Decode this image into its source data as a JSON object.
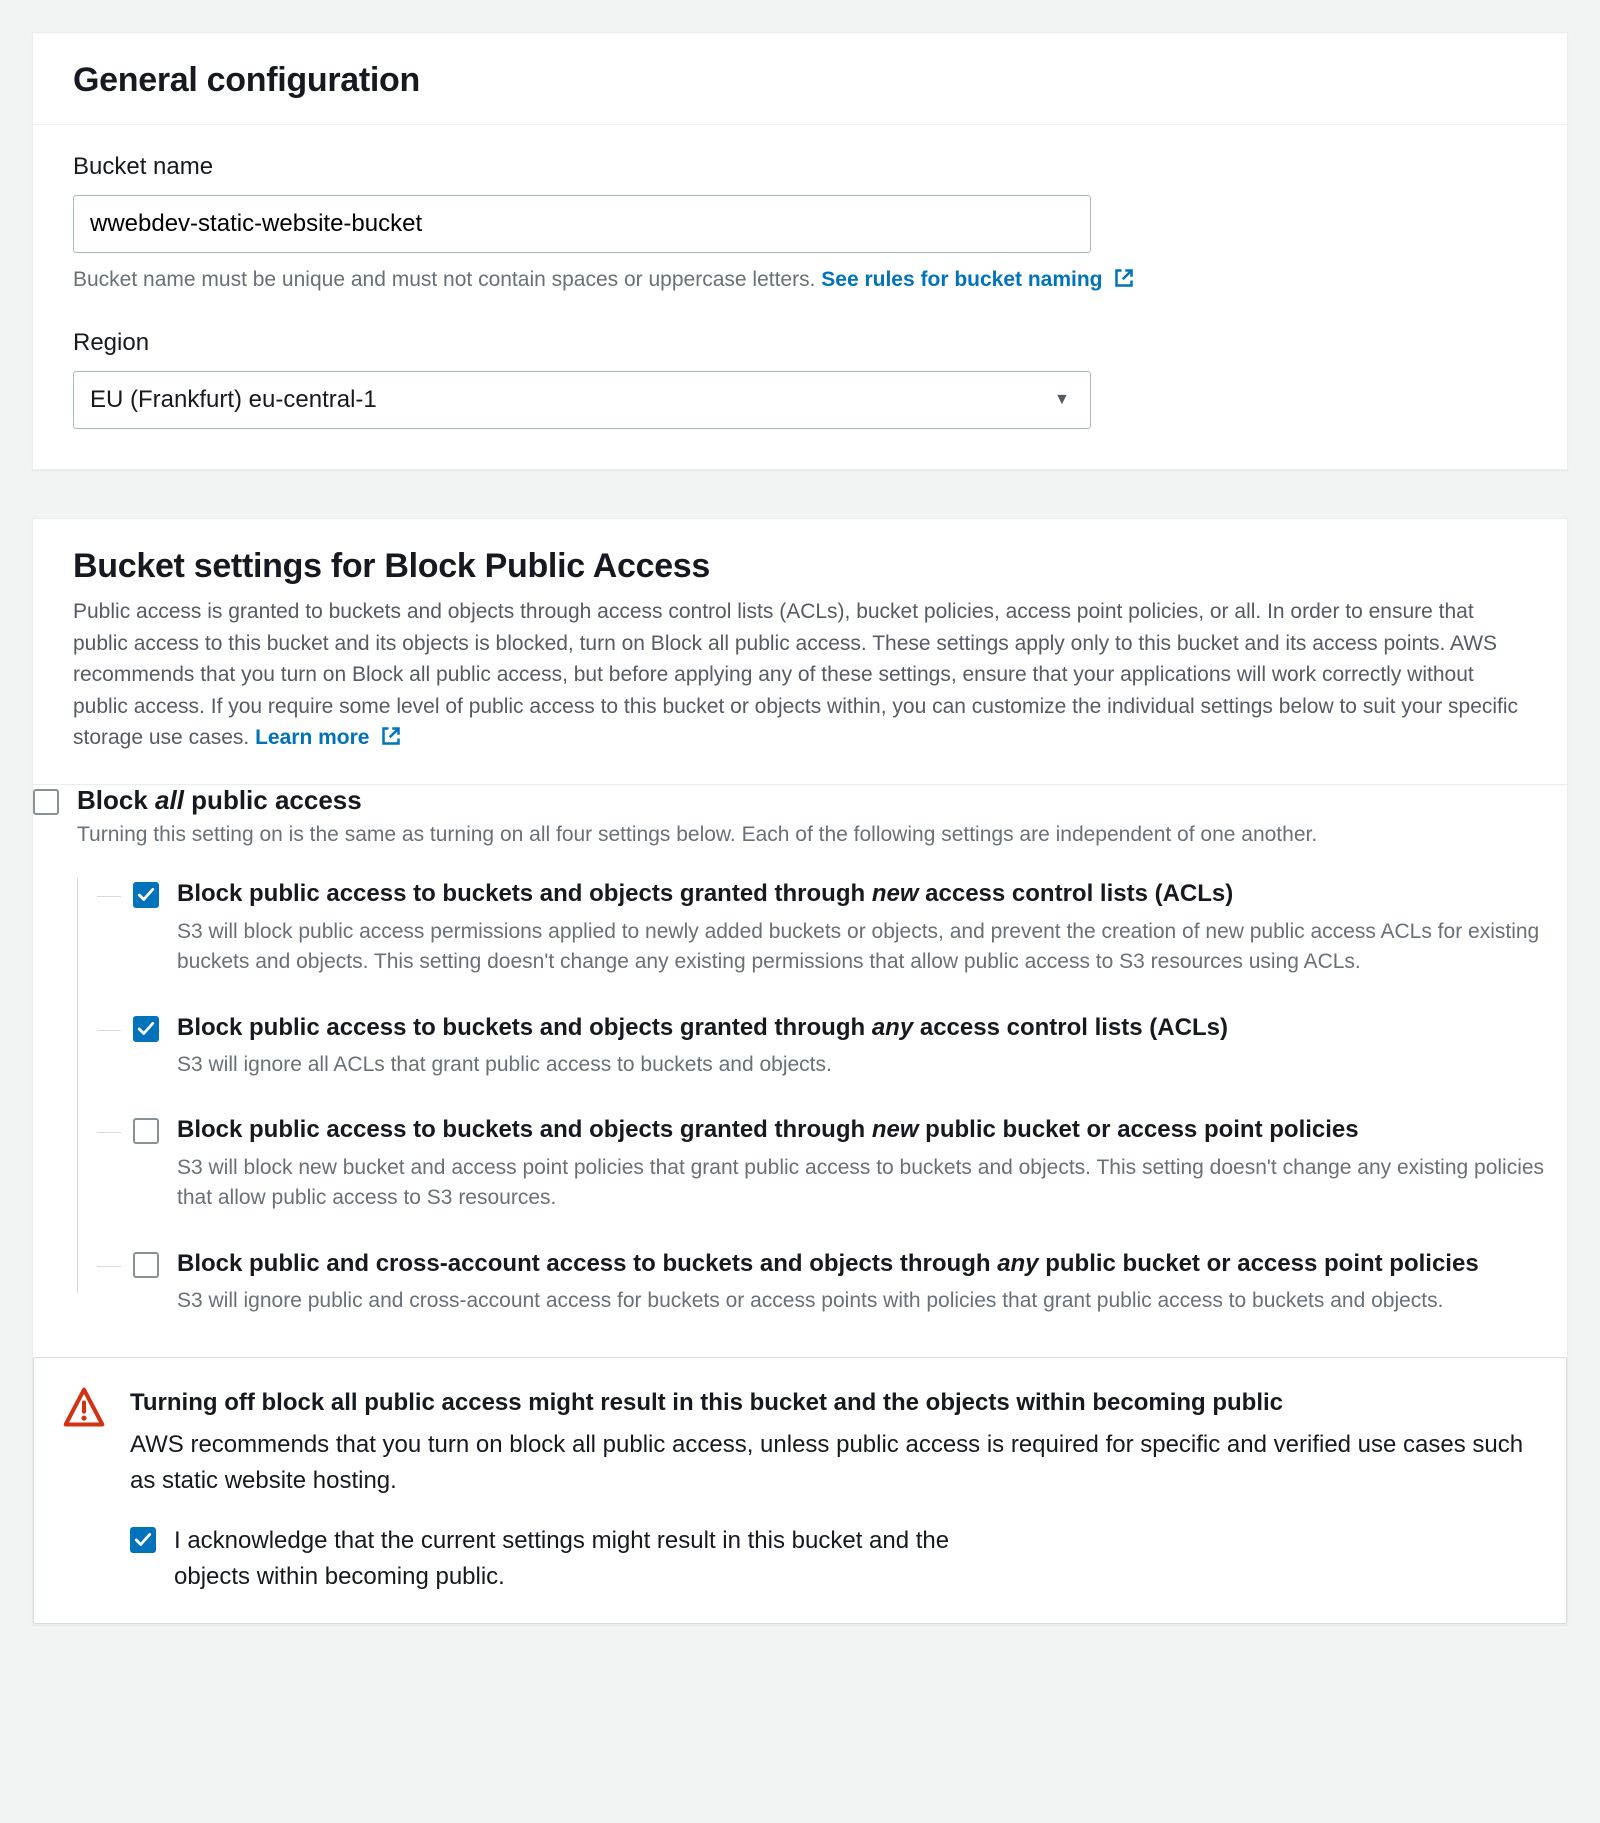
{
  "general": {
    "title": "General configuration",
    "bucket_name_label": "Bucket name",
    "bucket_name_value": "wwebdev-static-website-bucket",
    "bucket_name_hint_prefix": "Bucket name must be unique and must not contain spaces or uppercase letters. ",
    "bucket_name_hint_link": "See rules for bucket naming",
    "region_label": "Region",
    "region_value": "EU (Frankfurt) eu-central-1"
  },
  "block_public": {
    "title": "Bucket settings for Block Public Access",
    "description_prefix": "Public access is granted to buckets and objects through access control lists (ACLs), bucket policies, access point policies, or all. In order to ensure that public access to this bucket and its objects is blocked, turn on Block all public access. These settings apply only to this bucket and its access points. AWS recommends that you turn on Block all public access, but before applying any of these settings, ensure that your applications will work correctly without public access. If you require some level of public access to this bucket or objects within, you can customize the individual settings below to suit your specific storage use cases. ",
    "learn_more": "Learn more",
    "root": {
      "checked": false,
      "title_pre": "Block ",
      "title_em": "all",
      "title_post": " public access",
      "desc": "Turning this setting on is the same as turning on all four settings below. Each of the following settings are independent of one another."
    },
    "children": [
      {
        "checked": true,
        "title_pre": "Block public access to buckets and objects granted through ",
        "title_em": "new",
        "title_post": " access control lists (ACLs)",
        "desc": "S3 will block public access permissions applied to newly added buckets or objects, and prevent the creation of new public access ACLs for existing buckets and objects. This setting doesn't change any existing permissions that allow public access to S3 resources using ACLs."
      },
      {
        "checked": true,
        "title_pre": "Block public access to buckets and objects granted through ",
        "title_em": "any",
        "title_post": " access control lists (ACLs)",
        "desc": "S3 will ignore all ACLs that grant public access to buckets and objects."
      },
      {
        "checked": false,
        "title_pre": "Block public access to buckets and objects granted through ",
        "title_em": "new",
        "title_post": " public bucket or access point policies",
        "desc": "S3 will block new bucket and access point policies that grant public access to buckets and objects. This setting doesn't change any existing policies that allow public access to S3 resources."
      },
      {
        "checked": false,
        "title_pre": "Block public and cross-account access to buckets and objects through ",
        "title_em": "any",
        "title_post": " public bucket or access point policies",
        "desc": "S3 will ignore public and cross-account access for buckets or access points with policies that grant public access to buckets and objects."
      }
    ],
    "alert": {
      "title": "Turning off block all public access might result in this bucket and the objects within becoming public",
      "text": "AWS recommends that you turn on block all public access, unless public access is required for specific and verified use cases such as static website hosting.",
      "ack_checked": true,
      "ack_text": "I acknowledge that the current settings might result in this bucket and the objects within becoming public."
    }
  }
}
